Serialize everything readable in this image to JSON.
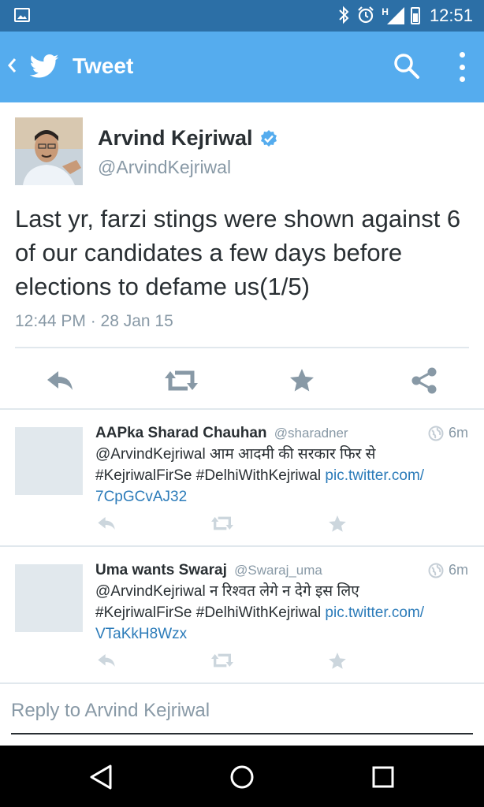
{
  "status_bar": {
    "time": "12:51",
    "icons": [
      "image-icon",
      "bluetooth-icon",
      "alarm-icon",
      "signal-icon",
      "battery-icon"
    ],
    "network": "H"
  },
  "app_bar": {
    "title": "Tweet",
    "color": "#55acee"
  },
  "tweet": {
    "author_name": "Arvind Kejriwal",
    "author_handle": "@ArvindKejriwal",
    "text": "Last yr, farzi stings were shown against 6 of our candidates a few days before elections to defame us(1/5)",
    "timestamp": "12:44 PM · 28 Jan 15",
    "verified_color": "#55acee"
  },
  "replies": [
    {
      "name": "AAPka Sharad Chauhan",
      "handle": "@sharadner",
      "time": "6m",
      "text_line1": "@ArvindKejriwal आम आदमी की सरकार फिर से",
      "text_line2_prefix": "#KejriwalFirSe #DelhiWithKejriwal ",
      "text_link1": "pic.twitter.com/",
      "text_link2": "7CpGCvAJ32"
    },
    {
      "name": "Uma wants Swaraj",
      "handle": "@Swaraj_uma",
      "time": "6m",
      "text_line1": "@ArvindKejriwal न रिश्वत लेगे न देगे इस लिए",
      "text_line2_prefix": "#KejriwalFirSe #DelhiWithKejriwal ",
      "text_link1": "pic.twitter.com/",
      "text_link2": "VTaKkH8Wzx"
    }
  ],
  "reply_box": {
    "placeholder": "Reply to Arvind Kejriwal"
  },
  "colors": {
    "link": "#2b7bb9",
    "muted": "#8899a6",
    "status_bar": "#2c6fa6"
  }
}
